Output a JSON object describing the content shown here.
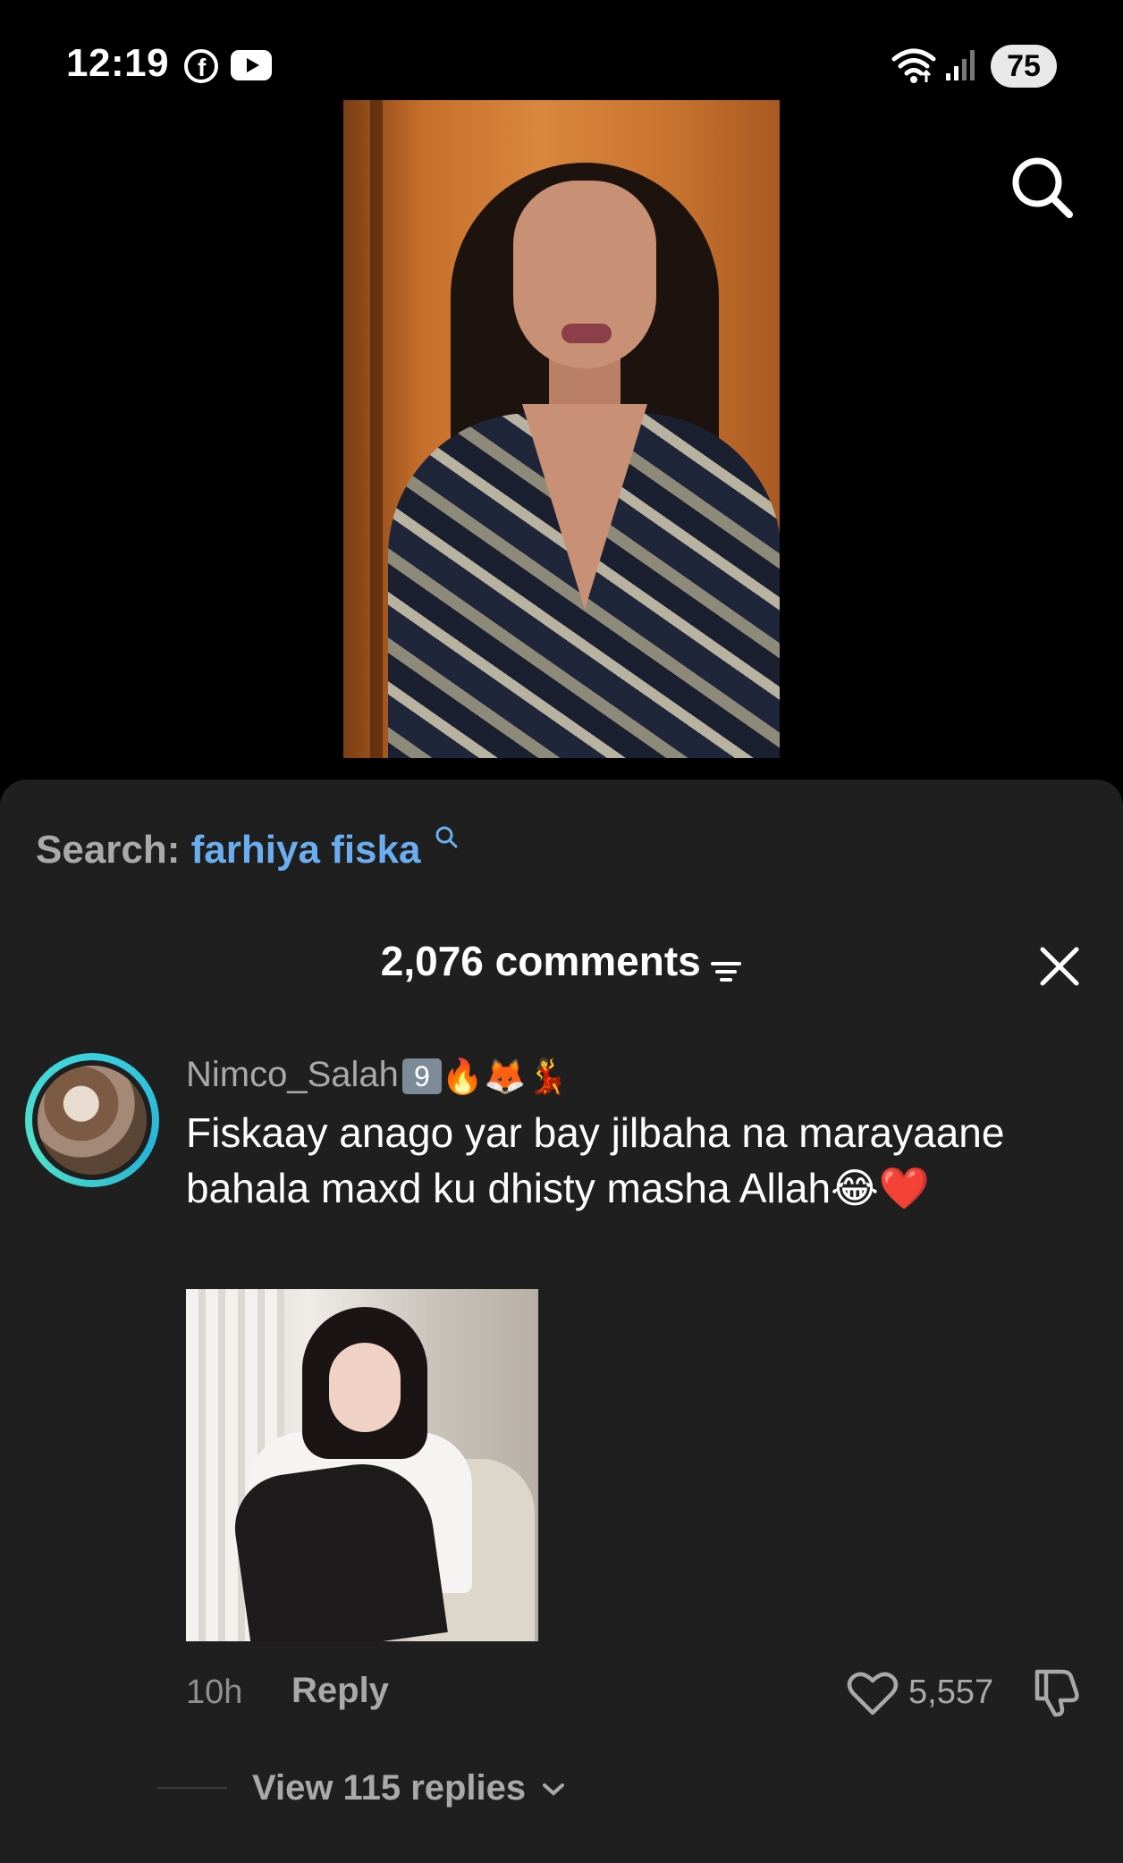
{
  "status_bar": {
    "time": "12:19",
    "battery": "75"
  },
  "search": {
    "prefix": "Search:",
    "term": "farhiya fiska"
  },
  "comments_header": {
    "count_label": "2,076 comments"
  },
  "comment": {
    "username": "Nimco_Salah",
    "username_badge": "9",
    "username_emojis": "🔥🦊💃",
    "text": "Fiskaay anago yar bay jilbaha na marayaane bahala maxd ku dhisty masha Allah😂❤️",
    "time_ago": "10h",
    "reply_label": "Reply",
    "like_count": "5,557",
    "view_replies_label": "View 115 replies"
  },
  "colors": {
    "accent_link": "#6aaef0",
    "sheet_bg": "#1f1f1f",
    "avatar_ring": "#3ad0e0"
  },
  "icons": [
    "facebook-icon",
    "youtube-icon",
    "wifi-icon",
    "signal-icon",
    "search-icon",
    "filter-icon",
    "close-icon",
    "heart-icon",
    "dislike-icon",
    "chevron-down-icon"
  ]
}
